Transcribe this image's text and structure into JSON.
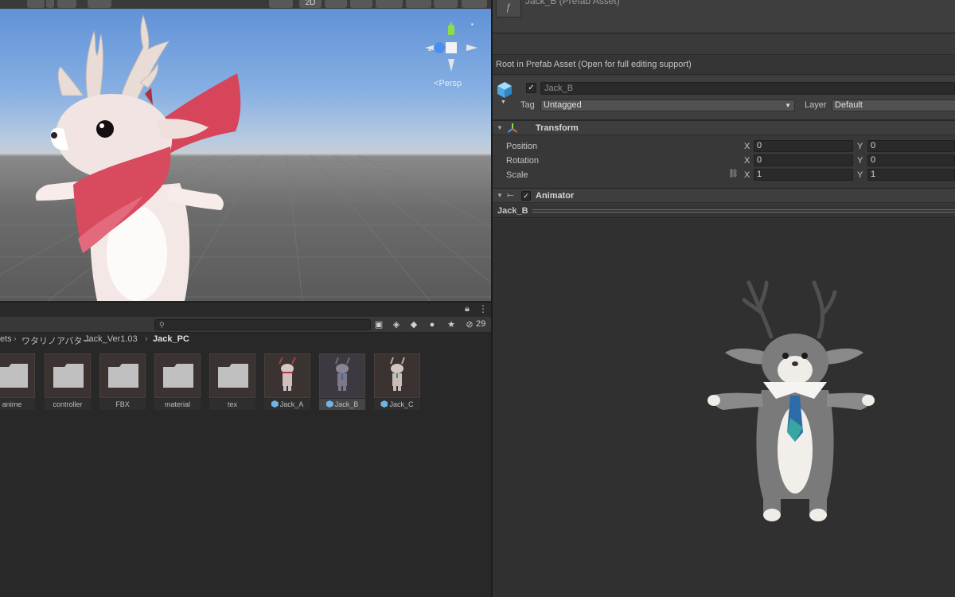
{
  "scene": {
    "toolbar": {
      "mode_2d": "2D"
    },
    "view_mode": "Persp"
  },
  "project": {
    "hidden_count": "29",
    "search": {
      "placeholder": ""
    },
    "breadcrumb": [
      "ets",
      "ワタリノアバター",
      "Jack_Ver1.03",
      "Jack_PC"
    ],
    "assets": [
      {
        "label": "anime",
        "kind": "folder"
      },
      {
        "label": "controller",
        "kind": "folder"
      },
      {
        "label": "FBX",
        "kind": "folder"
      },
      {
        "label": "material",
        "kind": "folder"
      },
      {
        "label": "tex",
        "kind": "folder"
      },
      {
        "label": "Jack_A",
        "kind": "prefab"
      },
      {
        "label": "Jack_B",
        "kind": "prefab",
        "selected": true
      },
      {
        "label": "Jack_C",
        "kind": "prefab"
      }
    ]
  },
  "inspector": {
    "title": "Jack_B (Prefab Asset)",
    "root_note": "Root in Prefab Asset (Open for full editing support)",
    "gameobject": {
      "active": "✓",
      "name": "Jack_B",
      "tag_label": "Tag",
      "tag_value": "Untagged",
      "layer_label": "Layer",
      "layer_value": "Default"
    },
    "transform": {
      "title": "Transform",
      "position": {
        "label": "Position",
        "x": "0",
        "y": "0"
      },
      "rotation": {
        "label": "Rotation",
        "x": "0",
        "y": "0"
      },
      "scale": {
        "label": "Scale",
        "x": "1",
        "y": "1"
      },
      "axis_x": "X",
      "axis_y": "Y"
    },
    "animator": {
      "title": "Animator",
      "enabled": "✓"
    },
    "preview": {
      "name": "Jack_B"
    }
  },
  "colors": {
    "accent_selected": "#454545",
    "prefab_blue": "#6fb6e8",
    "scarf_red": "#d6455a",
    "tie_blue": "#2d6aa8"
  }
}
